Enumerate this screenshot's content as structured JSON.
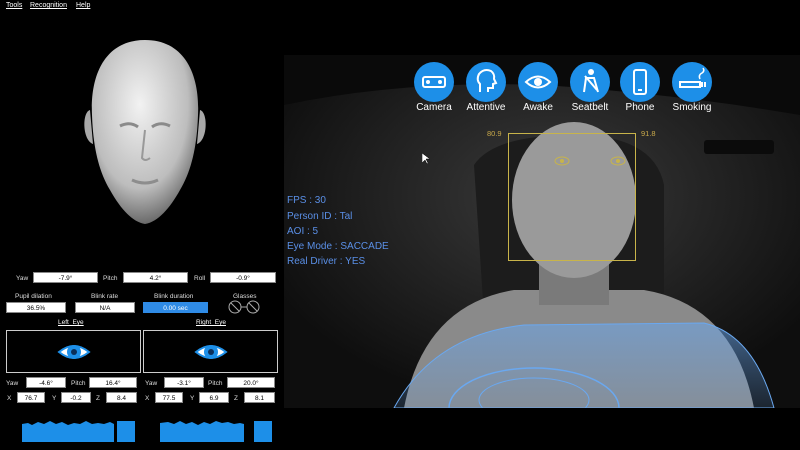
{
  "menu": [
    "Tools",
    "Recognition",
    "Help"
  ],
  "head_pose": {
    "yaw_label": "Yaw",
    "yaw_value": "-7.9°",
    "pitch_label": "Pitch",
    "pitch_value": "4.2°",
    "roll_label": "Roll",
    "roll_value": "-0.9°"
  },
  "metrics": {
    "pupil_label": "Pupil dilation",
    "pupil_value": "36.5%",
    "blink_rate_label": "Blink rate",
    "blink_rate_value": "N/A",
    "blink_duration_label": "Blink duration",
    "blink_duration_value": "0.00 sec",
    "glasses_label": "Glasses"
  },
  "left_eye": {
    "title": "Left_Eye",
    "yaw_label": "Yaw",
    "yaw_value": "-4.6°",
    "pitch_label": "Pitch",
    "pitch_value": "16.4°",
    "x_label": "X",
    "x_value": "76.7",
    "y_label": "Y",
    "y_value": "-0.2",
    "z_label": "Z",
    "z_value": "8.4"
  },
  "right_eye": {
    "title": "Right_Eye",
    "yaw_label": "Yaw",
    "yaw_value": "-3.1°",
    "pitch_label": "Pitch",
    "pitch_value": "20.0°",
    "x_label": "X",
    "x_value": "77.5",
    "y_label": "Y",
    "y_value": "6.9",
    "z_label": "Z",
    "z_value": "8.1"
  },
  "status_icons": [
    "Camera",
    "Attentive",
    "Awake",
    "Seatbelt",
    "Phone",
    "Smoking"
  ],
  "overlay": {
    "fps": "FPS : 30",
    "person": "Person ID : Tal",
    "aoi": "AOI : 5",
    "eye_mode": "Eye Mode : SACCADE",
    "real_driver": "Real Driver : YES",
    "face_left_value": "80.9",
    "face_right_value": "91.8"
  },
  "colors": {
    "accent": "#1d8fe8",
    "overlay_text": "#5a8fe6",
    "face_box": "#c8b44a"
  }
}
